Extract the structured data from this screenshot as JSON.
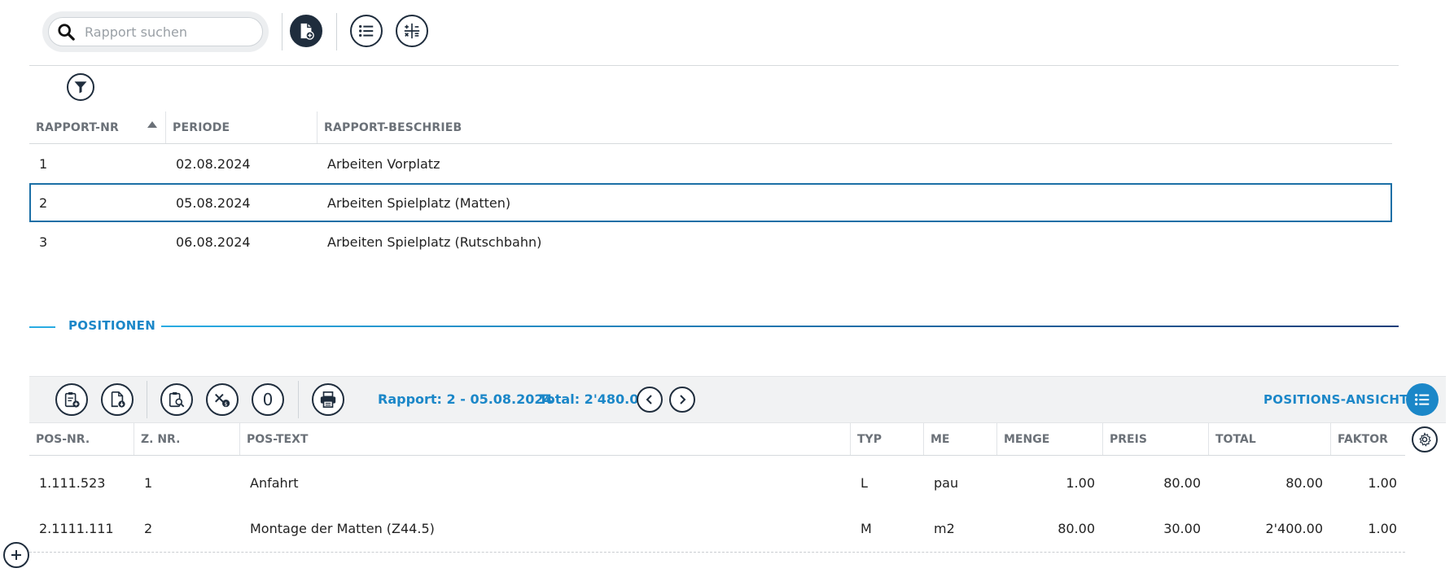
{
  "search": {
    "placeholder": "Rapport suchen"
  },
  "reports": {
    "columns": [
      "RAPPORT-NR",
      "PERIODE",
      "RAPPORT-BESCHRIEB"
    ],
    "rows": [
      {
        "nr": "1",
        "periode": "02.08.2024",
        "beschrieb": "Arbeiten Vorplatz"
      },
      {
        "nr": "2",
        "periode": "05.08.2024",
        "beschrieb": "Arbeiten Spielplatz (Matten)"
      },
      {
        "nr": "3",
        "periode": "06.08.2024",
        "beschrieb": "Arbeiten Spielplatz (Rutschbahn)"
      }
    ],
    "selected_row": "2"
  },
  "positions": {
    "section_title": "POSITIONEN",
    "rapport_info": "Rapport: 2 - 05.08.2024",
    "total_info": "Total: 2'480.00",
    "zero_label": "0",
    "view_label": "POSITIONS-ANSICHT",
    "columns": [
      "POS-NR.",
      "Z. NR.",
      "POS-TEXT",
      "TYP",
      "ME",
      "MENGE",
      "PREIS",
      "TOTAL",
      "FAKTOR"
    ],
    "rows": [
      {
        "posnr": "1.111.523",
        "znr": "1",
        "text": "Anfahrt",
        "typ": "L",
        "me": "pau",
        "menge": "1.00",
        "preis": "80.00",
        "total": "80.00",
        "faktor": "1.00"
      },
      {
        "posnr": "2.1111.111",
        "znr": "2",
        "text": "Montage der Matten (Z44.5)",
        "typ": "M",
        "me": "m2",
        "menge": "80.00",
        "preis": "30.00",
        "total": "2'400.00",
        "faktor": "1.00"
      }
    ]
  },
  "colors": {
    "accent": "#1b87c8",
    "dark": "#1f2d3d",
    "selection": "#1b6fa6"
  }
}
